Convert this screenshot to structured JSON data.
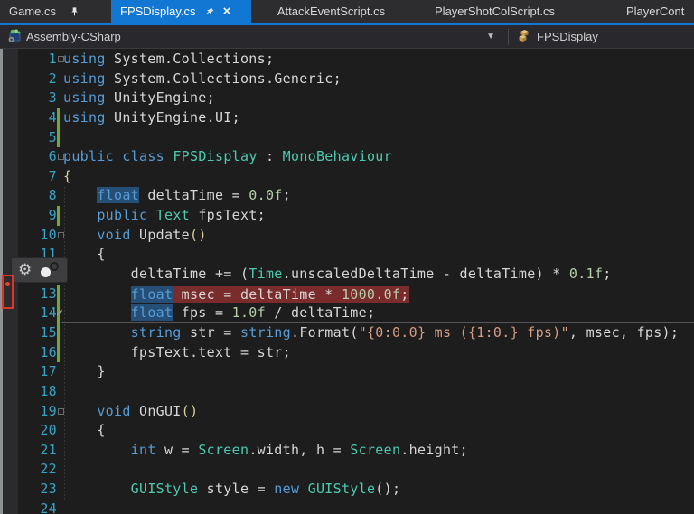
{
  "tabs": {
    "items": [
      {
        "label": "Game.cs",
        "pinned": true,
        "active": false,
        "closable": false
      },
      {
        "label": "FPSDisplay.cs",
        "pinned": true,
        "active": true,
        "closable": true,
        "close_label": "×"
      },
      {
        "label": "AttackEventScript.cs",
        "pinned": false,
        "active": false,
        "closable": false
      },
      {
        "label": "PlayerShotColScript.cs",
        "pinned": false,
        "active": false,
        "closable": false
      },
      {
        "label": "PlayerCont",
        "pinned": false,
        "active": false,
        "closable": false
      }
    ],
    "active_tab_color": "#1177d2"
  },
  "navbar": {
    "project": "Assembly-CSharp",
    "symbol": "FPSDisplay",
    "project_icon": "csharp-project-icon",
    "symbol_icon": "class-icon",
    "dropdown_icon": "chevron-down-icon"
  },
  "editor": {
    "colors": {
      "keyword": "#569cd6",
      "type": "#4ec9b0",
      "plain": "#d6d6d6",
      "string": "#d69d85",
      "number": "#b5cea8",
      "line_number": "#38a2c4",
      "reference_highlight_bg": "#264f78",
      "breakpoint_line_bg": "#7a2b2b",
      "changed_line_bar": "#76a33c",
      "active_tab": "#1177d2",
      "annotation_red": "#dc352b"
    },
    "margin_popup_icons": [
      "gear-icon",
      "circles-icon"
    ],
    "annotations": [
      "red-box-around-breakpoint-dot",
      "breakpoint-dot-line-13"
    ],
    "lines": [
      {
        "n": 1,
        "fold": true,
        "segs": [
          {
            "t": "using",
            "c": "kw"
          },
          {
            "t": " System.Collections;",
            "c": "pl"
          }
        ]
      },
      {
        "n": 2,
        "segs": [
          {
            "t": "using",
            "c": "kw"
          },
          {
            "t": " System.Collections.Generic;",
            "c": "pl"
          }
        ]
      },
      {
        "n": 3,
        "segs": [
          {
            "t": "using",
            "c": "kw"
          },
          {
            "t": " UnityEngine;",
            "c": "pl"
          }
        ]
      },
      {
        "n": 4,
        "chg": true,
        "segs": [
          {
            "t": "using",
            "c": "kw"
          },
          {
            "t": " UnityEngine.UI;",
            "c": "pl"
          }
        ]
      },
      {
        "n": 5,
        "chg": true,
        "segs": []
      },
      {
        "n": 6,
        "fold": true,
        "segs": [
          {
            "t": "public",
            "c": "kw"
          },
          {
            "t": " ",
            "c": "pl"
          },
          {
            "t": "class",
            "c": "kw"
          },
          {
            "t": " ",
            "c": "pl"
          },
          {
            "t": "FPSDisplay",
            "c": "ty"
          },
          {
            "t": " : ",
            "c": "pl"
          },
          {
            "t": "MonoBehaviour",
            "c": "ty"
          }
        ]
      },
      {
        "n": 7,
        "segs": [
          {
            "t": "{",
            "c": "gold"
          }
        ]
      },
      {
        "n": 8,
        "segs": [
          {
            "t": "    ",
            "c": "pl"
          },
          {
            "t": "float",
            "c": "kw",
            "bg": "ref"
          },
          {
            "t": " deltaTime = ",
            "c": "pl"
          },
          {
            "t": "0.0f",
            "c": "num"
          },
          {
            "t": ";",
            "c": "pl"
          }
        ]
      },
      {
        "n": 9,
        "chg": true,
        "segs": [
          {
            "t": "    ",
            "c": "pl"
          },
          {
            "t": "public",
            "c": "kw"
          },
          {
            "t": " ",
            "c": "pl"
          },
          {
            "t": "Text",
            "c": "ty"
          },
          {
            "t": " fpsText;",
            "c": "pl"
          }
        ]
      },
      {
        "n": 10,
        "fold": true,
        "segs": [
          {
            "t": "    ",
            "c": "pl"
          },
          {
            "t": "void",
            "c": "kw"
          },
          {
            "t": " Update",
            "c": "pl"
          },
          {
            "t": "()",
            "c": "gold"
          }
        ]
      },
      {
        "n": 11,
        "segs": [
          {
            "t": "    {",
            "c": "pl"
          }
        ]
      },
      {
        "n": 12,
        "segs": [
          {
            "t": "        deltaTime += (",
            "c": "pl"
          },
          {
            "t": "Time",
            "c": "ty"
          },
          {
            "t": ".unscaledDeltaTime - deltaTime) * ",
            "c": "pl"
          },
          {
            "t": "0.1f",
            "c": "num"
          },
          {
            "t": ";",
            "c": "pl"
          }
        ]
      },
      {
        "n": 13,
        "chg": true,
        "boxtop": true,
        "segs": [
          {
            "t": "        ",
            "c": "pl"
          },
          {
            "t": "float",
            "c": "kw",
            "bg": "ref"
          },
          {
            "t": " msec = deltaTime * ",
            "c": "pl",
            "bg": "bp"
          },
          {
            "t": "1000.0f",
            "c": "num",
            "bg": "bp"
          },
          {
            "t": ";",
            "c": "pl",
            "bg": "bp"
          }
        ]
      },
      {
        "n": 14,
        "chg": true,
        "caret": true,
        "pencil": true,
        "segs": [
          {
            "t": "        ",
            "c": "pl"
          },
          {
            "t": "float",
            "c": "kw",
            "bg": "ref"
          },
          {
            "t": " fps = ",
            "c": "pl"
          },
          {
            "t": "1.0f",
            "c": "num"
          },
          {
            "t": " / deltaTime;",
            "c": "pl"
          }
        ]
      },
      {
        "n": 15,
        "chg": true,
        "segs": [
          {
            "t": "        ",
            "c": "pl"
          },
          {
            "t": "string",
            "c": "kw"
          },
          {
            "t": " str = ",
            "c": "pl"
          },
          {
            "t": "string",
            "c": "kw"
          },
          {
            "t": ".Format(",
            "c": "pl"
          },
          {
            "t": "\"{0:0.0} ms ({1:0.} fps)\"",
            "c": "str"
          },
          {
            "t": ", msec, fps);",
            "c": "pl"
          }
        ]
      },
      {
        "n": 16,
        "chg": true,
        "segs": [
          {
            "t": "        fpsText.text = str;",
            "c": "pl"
          }
        ]
      },
      {
        "n": 17,
        "segs": [
          {
            "t": "    }",
            "c": "pl"
          }
        ]
      },
      {
        "n": 18,
        "segs": []
      },
      {
        "n": 19,
        "fold": true,
        "segs": [
          {
            "t": "    ",
            "c": "pl"
          },
          {
            "t": "void",
            "c": "kw"
          },
          {
            "t": " OnGUI",
            "c": "pl"
          },
          {
            "t": "()",
            "c": "gold"
          }
        ]
      },
      {
        "n": 20,
        "segs": [
          {
            "t": "    {",
            "c": "pl"
          }
        ]
      },
      {
        "n": 21,
        "segs": [
          {
            "t": "        ",
            "c": "pl"
          },
          {
            "t": "int",
            "c": "kw"
          },
          {
            "t": " w = ",
            "c": "pl"
          },
          {
            "t": "Screen",
            "c": "ty"
          },
          {
            "t": ".width, h = ",
            "c": "pl"
          },
          {
            "t": "Screen",
            "c": "ty"
          },
          {
            "t": ".height;",
            "c": "pl"
          }
        ]
      },
      {
        "n": 22,
        "segs": []
      },
      {
        "n": 23,
        "segs": [
          {
            "t": "        ",
            "c": "pl"
          },
          {
            "t": "GUIStyle",
            "c": "ty"
          },
          {
            "t": " style = ",
            "c": "pl"
          },
          {
            "t": "new",
            "c": "kw"
          },
          {
            "t": " ",
            "c": "pl"
          },
          {
            "t": "GUIStyle",
            "c": "ty"
          },
          {
            "t": "();",
            "c": "pl"
          }
        ]
      },
      {
        "n": 24,
        "segs": []
      }
    ]
  }
}
